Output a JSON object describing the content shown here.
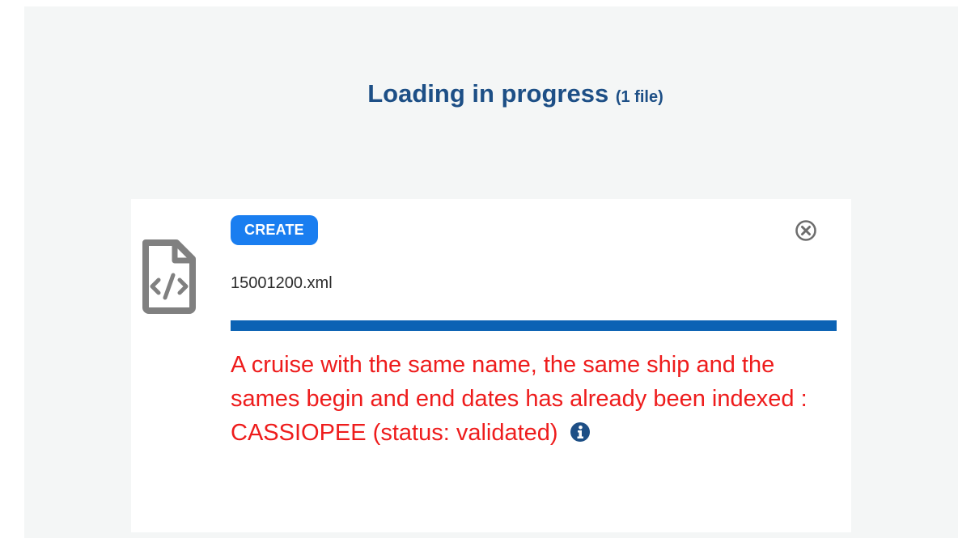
{
  "header": {
    "title": "Loading in progress",
    "count_label": "(1 file)"
  },
  "upload": {
    "badge": "CREATE",
    "filename": "15001200.xml",
    "progress_percent": 100,
    "error_message": "A cruise with the same name, the same ship and the sames begin and end dates has already been indexed : CASSIOPEE (status: validated)",
    "file_icon": "file-code-icon",
    "close_icon": "close-circle-icon",
    "info_icon": "info-circle-icon"
  },
  "colors": {
    "title": "#1d4f86",
    "badge": "#1a7ef0",
    "progress": "#0b62b4",
    "error": "#ee1c1c",
    "background": "#f4f6f6"
  }
}
